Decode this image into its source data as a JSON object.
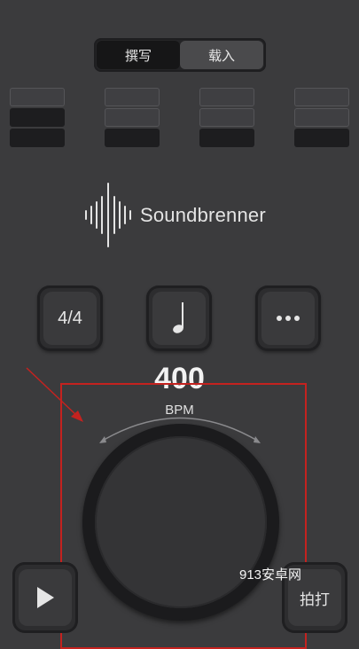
{
  "mode_toggle": {
    "compose_label": "撰写",
    "load_label": "载入"
  },
  "beats": [
    {
      "bars": [
        "empty",
        "filled",
        "filled"
      ]
    },
    {
      "bars": [
        "empty",
        "empty",
        "filled"
      ]
    },
    {
      "bars": [
        "empty",
        "empty",
        "filled"
      ]
    },
    {
      "bars": [
        "empty",
        "empty",
        "filled"
      ]
    }
  ],
  "logo": {
    "text": "Soundbrenner"
  },
  "controls": {
    "time_signature": "4/4",
    "note_icon": "quarter-note-icon",
    "more_icon": "more-dots-icon"
  },
  "tempo": {
    "value": "400",
    "unit": "BPM"
  },
  "bottom": {
    "play_icon": "play-icon",
    "tap_label": "拍打"
  },
  "watermark": {
    "text": "913安卓网"
  },
  "colors": {
    "highlight": "#c4221f",
    "background": "#3b3b3d"
  }
}
